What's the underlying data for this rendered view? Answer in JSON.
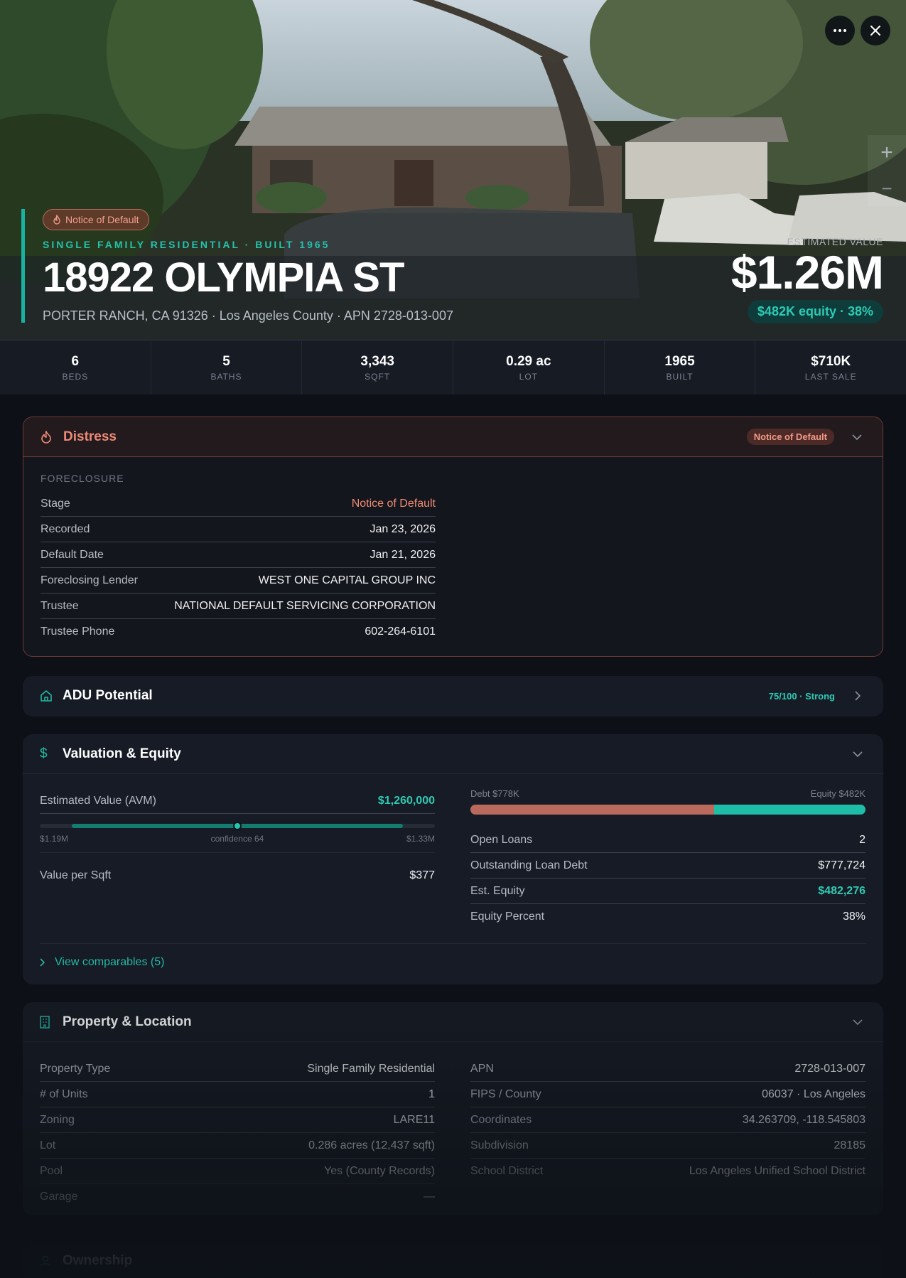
{
  "hero": {
    "badge": "Notice of Default",
    "kicker": "SINGLE FAMILY RESIDENTIAL · BUILT 1965",
    "address": "18922 OLYMPIA ST",
    "subaddress": "PORTER RANCH, CA 91326 · Los Angeles County · APN 2728-013-007",
    "estimated_label": "ESTIMATED VALUE",
    "estimated_value": "$1.26M",
    "equity": "$482K equity · 38%",
    "zoom_in": "+",
    "zoom_out": "−"
  },
  "stats": [
    {
      "value": "6",
      "label": "BEDS"
    },
    {
      "value": "5",
      "label": "BATHS"
    },
    {
      "value": "3,343",
      "label": "SQFT"
    },
    {
      "value": "0.29 ac",
      "label": "LOT"
    },
    {
      "value": "1965",
      "label": "BUILT"
    },
    {
      "value": "$710K",
      "label": "LAST SALE"
    }
  ],
  "distress": {
    "title": "Distress",
    "badge": "Notice of Default",
    "section": "FORECLOSURE",
    "rows": [
      {
        "k": "Stage",
        "v": "Notice of Default"
      },
      {
        "k": "Recorded",
        "v": "Jan 23, 2026"
      },
      {
        "k": "Default Date",
        "v": "Jan 21, 2026"
      },
      {
        "k": "Foreclosing Lender",
        "v": "WEST ONE CAPITAL GROUP INC"
      },
      {
        "k": "Trustee",
        "v": "NATIONAL DEFAULT SERVICING CORPORATION"
      },
      {
        "k": "Trustee Phone",
        "v": "602-264-6101"
      }
    ]
  },
  "adu": {
    "title": "ADU Potential",
    "score": "75/100 · Strong"
  },
  "valuation": {
    "title": "Valuation & Equity",
    "avm_label": "Estimated Value (AVM)",
    "avm_value": "$1,260,000",
    "range_low": "$1.19M",
    "confidence": "confidence 64",
    "range_high": "$1.33M",
    "confidence_score": 64,
    "vpsf_label": "Value per Sqft",
    "vpsf_value": "$377",
    "debt_label": "Debt $778K",
    "equity_label": "Equity $482K",
    "debt_share": 0.617,
    "rows": [
      {
        "k": "Open Loans",
        "v": "2"
      },
      {
        "k": "Outstanding Loan Debt",
        "v": "$777,724"
      },
      {
        "k": "Est. Equity",
        "v": "$482,276"
      },
      {
        "k": "Equity Percent",
        "v": "38%"
      }
    ],
    "comps": "View comparables (5)"
  },
  "property": {
    "title": "Property & Location",
    "left": [
      {
        "k": "Property Type",
        "v": "Single Family Residential"
      },
      {
        "k": "# of Units",
        "v": "1"
      },
      {
        "k": "Zoning",
        "v": "LARE11"
      },
      {
        "k": "Lot",
        "v": "0.286 acres (12,437 sqft)"
      },
      {
        "k": "Pool",
        "v": "Yes (County Records)"
      },
      {
        "k": "Garage",
        "v": "—"
      }
    ],
    "right": [
      {
        "k": "APN",
        "v": "2728-013-007"
      },
      {
        "k": "FIPS / County",
        "v": "06037 · Los Angeles"
      },
      {
        "k": "Coordinates",
        "v": "34.263709, -118.545803"
      },
      {
        "k": "Subdivision",
        "v": "28185"
      },
      {
        "k": "School District",
        "v": "Los Angeles Unified School District"
      }
    ]
  },
  "ownership": {
    "title": "Ownership"
  },
  "colors": {
    "accent": "#17b3a0",
    "distress": "#ee8a76",
    "debt": "#b96a5c",
    "equity": "#1ebda8"
  }
}
